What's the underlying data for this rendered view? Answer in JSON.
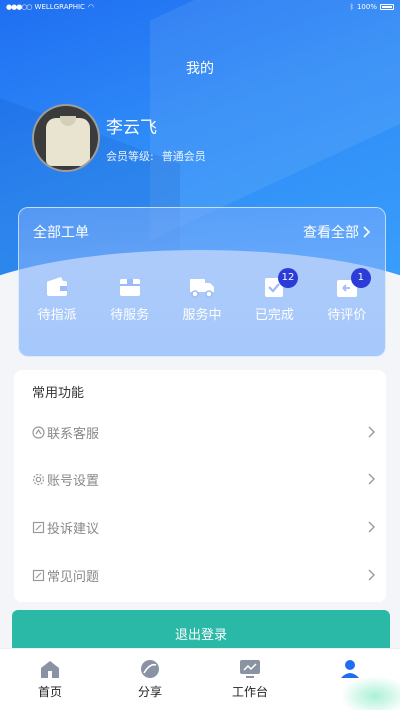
{
  "status_bar": {
    "carrier": "WELLGRAPHIC",
    "battery": "100%"
  },
  "page_title": "我的",
  "profile": {
    "name": "李云飞",
    "level_label": "会员等级:",
    "level_value": "普通会员"
  },
  "orders": {
    "title": "全部工单",
    "view_all": "查看全部",
    "items": [
      {
        "label": "待指派",
        "icon": "wallet-icon",
        "badge": ""
      },
      {
        "label": "待服务",
        "icon": "box-icon",
        "badge": ""
      },
      {
        "label": "服务中",
        "icon": "truck-icon",
        "badge": ""
      },
      {
        "label": "已完成",
        "icon": "check-clipboard-icon",
        "badge": "12"
      },
      {
        "label": "待评价",
        "icon": "return-box-icon",
        "badge": "1"
      }
    ]
  },
  "functions": {
    "title": "常用功能",
    "items": [
      {
        "label": "联系客服",
        "icon": "headset-icon"
      },
      {
        "label": "账号设置",
        "icon": "gear-icon"
      },
      {
        "label": "投诉建议",
        "icon": "edit-icon"
      },
      {
        "label": "常见问题",
        "icon": "edit-icon"
      }
    ]
  },
  "logout_label": "退出登录",
  "tabs": [
    {
      "label": "首页",
      "icon": "home-icon",
      "active": false
    },
    {
      "label": "分享",
      "icon": "share-icon",
      "active": false
    },
    {
      "label": "工作台",
      "icon": "monitor-icon",
      "active": false
    },
    {
      "label": "",
      "icon": "user-icon",
      "active": true
    }
  ],
  "colors": {
    "primary": "#1f6ef2",
    "logout": "#2ab8a7",
    "badge": "#2b3dd6"
  }
}
